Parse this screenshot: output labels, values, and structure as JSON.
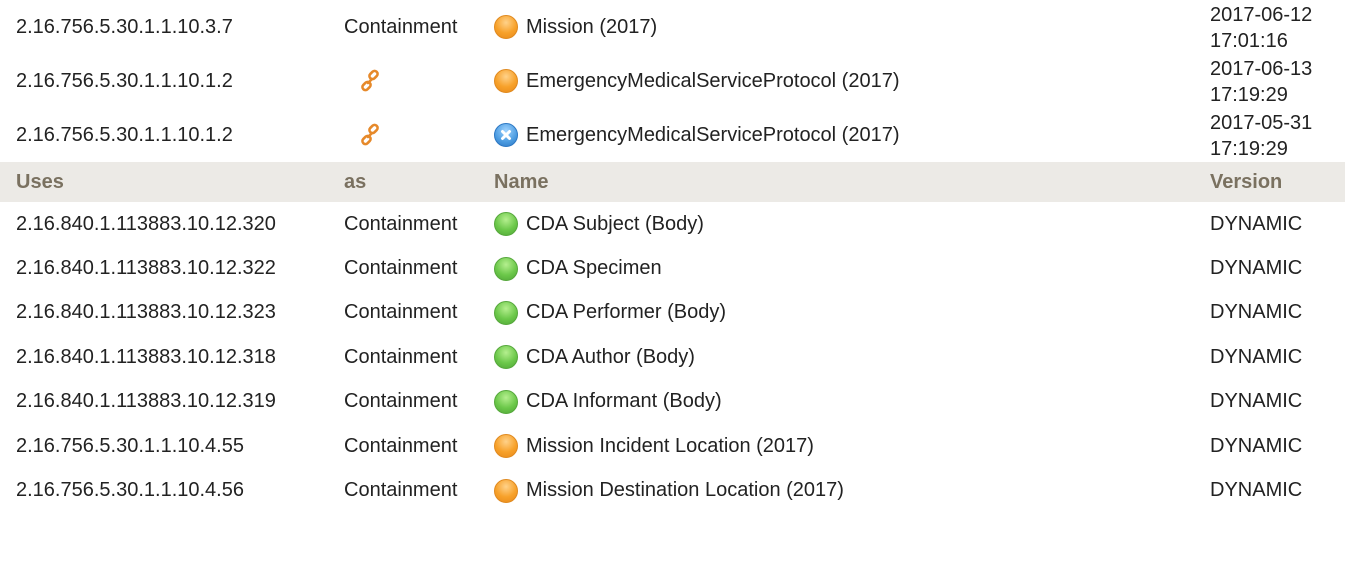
{
  "colors": {
    "header_bg": "#eceae6",
    "header_text": "#7a7160",
    "status_orange": "#f7a12a",
    "status_green": "#6cc84a",
    "status_blue": "#4b9be0",
    "link_icon": "#e6892a"
  },
  "used_by": [
    {
      "id": "2.16.756.5.30.1.1.10.3.7",
      "as": "Containment",
      "as_icon": "",
      "status_icon": "orange-status-icon",
      "name": "Mission (2017)",
      "version_date": "2017-06-12",
      "version_time": "17:01:16"
    },
    {
      "id": "2.16.756.5.30.1.1.10.1.2",
      "as": "",
      "as_icon": "link-icon",
      "status_icon": "orange-status-icon",
      "name": "EmergencyMedicalServiceProtocol (2017)",
      "version_date": "2017-06-13",
      "version_time": "17:19:29"
    },
    {
      "id": "2.16.756.5.30.1.1.10.1.2",
      "as": "",
      "as_icon": "link-icon",
      "status_icon": "blue-cancelled-status-icon",
      "name": "EmergencyMedicalServiceProtocol (2017)",
      "version_date": "2017-05-31",
      "version_time": "17:19:29"
    }
  ],
  "uses_header": {
    "col_uses": "Uses",
    "col_as": "as",
    "col_name": "Name",
    "col_version": "Version"
  },
  "uses": [
    {
      "id": "2.16.840.1.113883.10.12.320",
      "as": "Containment",
      "status_icon": "green-status-icon",
      "name": "CDA Subject (Body)",
      "version": "DYNAMIC"
    },
    {
      "id": "2.16.840.1.113883.10.12.322",
      "as": "Containment",
      "status_icon": "green-status-icon",
      "name": "CDA Specimen",
      "version": "DYNAMIC"
    },
    {
      "id": "2.16.840.1.113883.10.12.323",
      "as": "Containment",
      "status_icon": "green-status-icon",
      "name": "CDA Performer (Body)",
      "version": "DYNAMIC"
    },
    {
      "id": "2.16.840.1.113883.10.12.318",
      "as": "Containment",
      "status_icon": "green-status-icon",
      "name": "CDA Author (Body)",
      "version": "DYNAMIC"
    },
    {
      "id": "2.16.840.1.113883.10.12.319",
      "as": "Containment",
      "status_icon": "green-status-icon",
      "name": "CDA Informant (Body)",
      "version": "DYNAMIC"
    },
    {
      "id": "2.16.756.5.30.1.1.10.4.55",
      "as": "Containment",
      "status_icon": "orange-status-icon",
      "name": "Mission Incident Location (2017)",
      "version": "DYNAMIC"
    },
    {
      "id": "2.16.756.5.30.1.1.10.4.56",
      "as": "Containment",
      "status_icon": "orange-status-icon",
      "name": "Mission Destination Location (2017)",
      "version": "DYNAMIC"
    }
  ]
}
